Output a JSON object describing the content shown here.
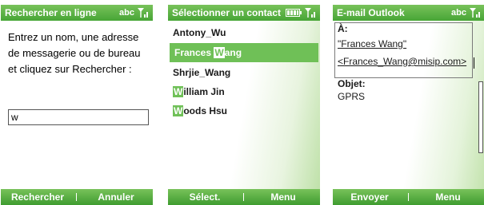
{
  "screen_search": {
    "title": "Rechercher en ligne",
    "input_mode": "abc",
    "prompt": "Entrez un nom, une adresse de messagerie ou de bureau et cliquez sur Rechercher :",
    "input_value": "w",
    "softkey_left": "Rechercher",
    "softkey_right": "Annuler"
  },
  "screen_contacts": {
    "title": "Sélectionner un contact",
    "contacts": [
      {
        "before": "Antony_Wu",
        "match": "",
        "after": ""
      },
      {
        "before": "Frances ",
        "match": "W",
        "after": "ang"
      },
      {
        "before": "Shrjie_Wang",
        "match": "",
        "after": ""
      },
      {
        "before": "",
        "match": "W",
        "after": "illiam Jin"
      },
      {
        "before": "",
        "match": "W",
        "after": "oods Hsu"
      }
    ],
    "selected_index": 1,
    "softkey_left": "Sélect.",
    "softkey_right": "Menu"
  },
  "screen_email": {
    "title": "E-mail Outlook",
    "input_mode": "abc",
    "to_label": "À:",
    "to_name": "\"Frances Wang\"",
    "to_address": "<Frances_Wang@misip.com>",
    "subject_label": "Objet:",
    "subject_value": "GPRS",
    "softkey_left": "Envoyer",
    "softkey_right": "Menu"
  },
  "colors": {
    "accent": "#6fc057",
    "bar_top": "#78c25a",
    "bar_bottom": "#3f9c30"
  },
  "icons": [
    "signal-icon",
    "battery-icon"
  ]
}
